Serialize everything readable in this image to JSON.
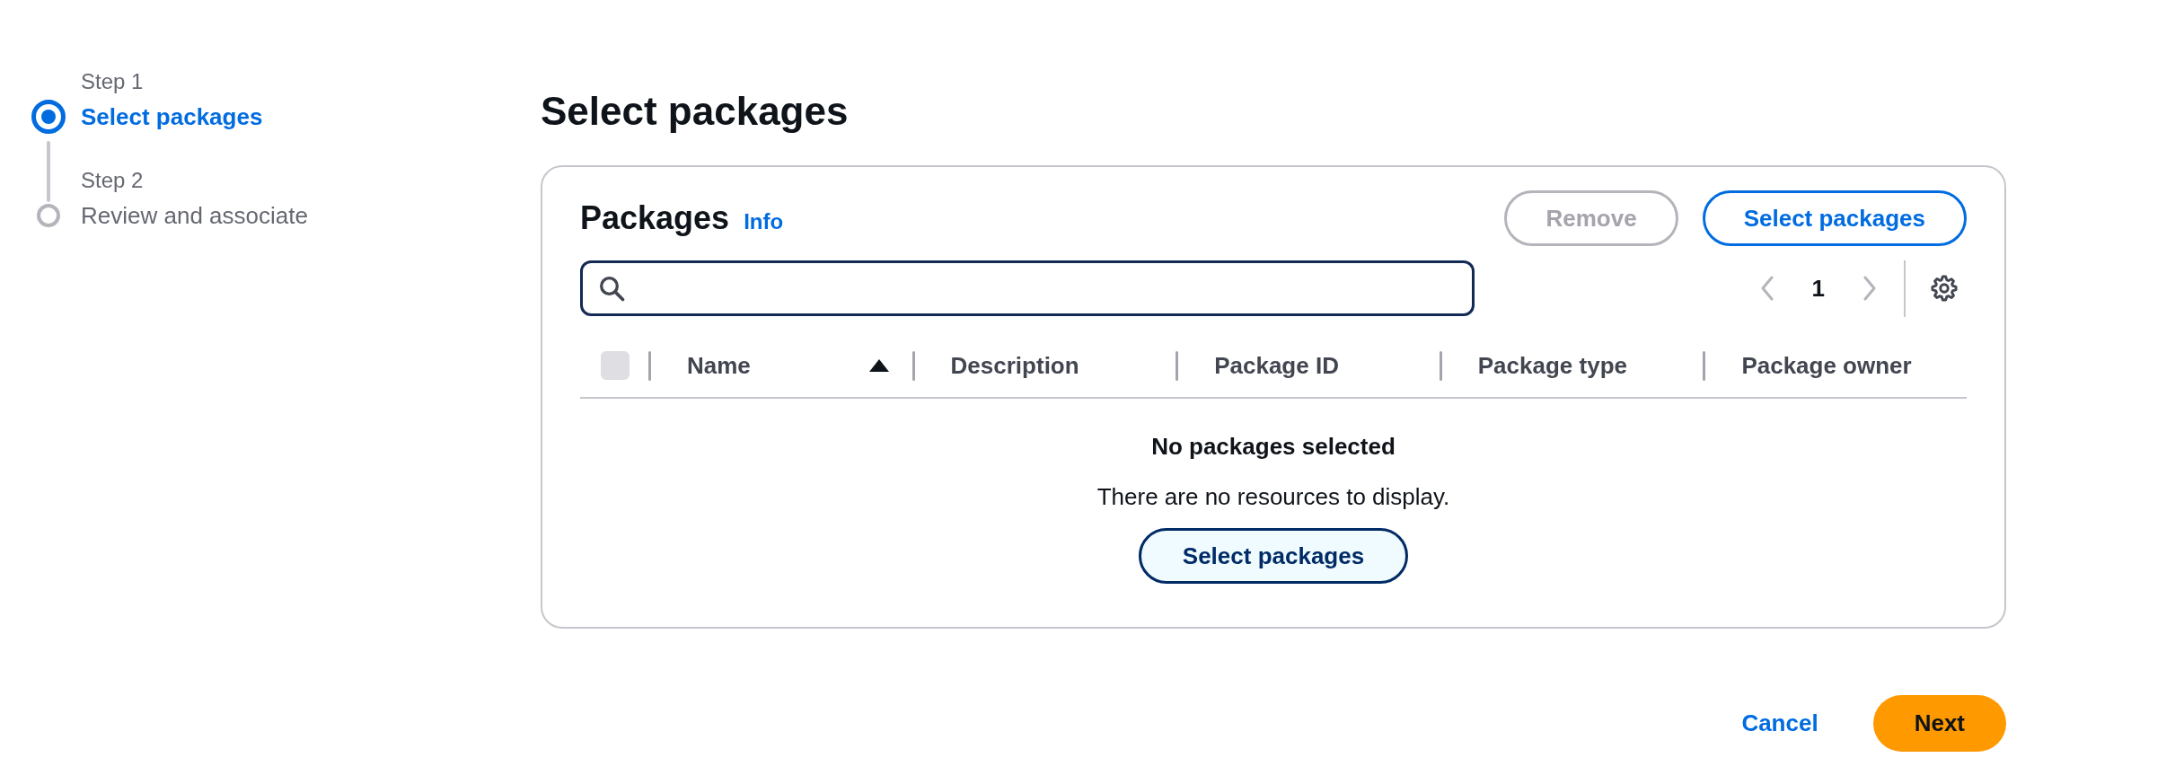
{
  "wizard_steps": [
    {
      "label": "Step 1",
      "title": "Select packages",
      "selected": true
    },
    {
      "label": "Step 2",
      "title": "Review and associate",
      "selected": false
    }
  ],
  "page": {
    "title": "Select packages"
  },
  "panel": {
    "title": "Packages",
    "info": "Info",
    "actions": [
      {
        "label": "Remove",
        "disabled": true
      },
      {
        "label": "Select packages",
        "disabled": false
      }
    ],
    "pagination": {
      "previous_disabled": true,
      "pages": [
        {
          "label": "1",
          "selected": true
        }
      ],
      "next_disabled": true
    },
    "table": {
      "select_all": {
        "checked": false,
        "disabled": true
      },
      "columns": [
        {
          "label": "Name",
          "sorted": true,
          "descending": false
        },
        {
          "label": "Description",
          "sorted": false
        },
        {
          "label": "Package ID",
          "sorted": false
        },
        {
          "label": "Package type",
          "sorted": false
        },
        {
          "label": "Package owner",
          "sorted": false
        }
      ]
    },
    "empty_state": {
      "title": "No packages selected",
      "message": "There are no resources to display.",
      "action": "Select packages"
    }
  },
  "footer": {
    "buttons": [
      {
        "label": "Cancel",
        "kind": "link"
      },
      {
        "label": "Next",
        "kind": "primary"
      }
    ]
  }
}
